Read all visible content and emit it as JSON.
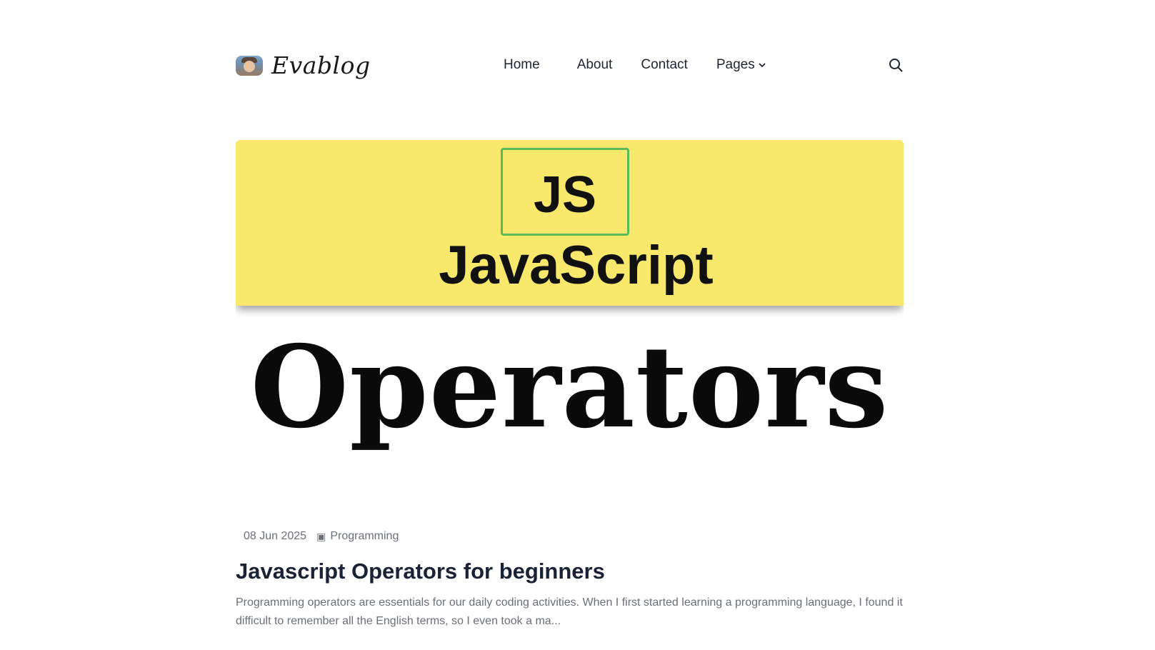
{
  "brand": {
    "name": "Evablog",
    "logo_icon": "avatar-logo"
  },
  "nav": {
    "items": [
      {
        "label": "Home"
      },
      {
        "label": "About"
      },
      {
        "label": "Contact"
      },
      {
        "label": "Pages",
        "has_dropdown": true
      }
    ],
    "search_icon": "search-icon"
  },
  "hero": {
    "badge_text": "JS",
    "title_line_1": "JavaScript",
    "title_line_2": "Operators",
    "band_color": "#f8e86c",
    "box_border_color": "#5cb85c"
  },
  "post": {
    "date": "08 Jun 2025",
    "category_icon": "folder-icon",
    "category": "Programming",
    "title": "Javascript Operators for beginners",
    "excerpt": "Programming operators are essentials for our daily coding activities. When I first started learning a programming language, I found it difficult to remember all the English terms, so I even took a ma..."
  }
}
